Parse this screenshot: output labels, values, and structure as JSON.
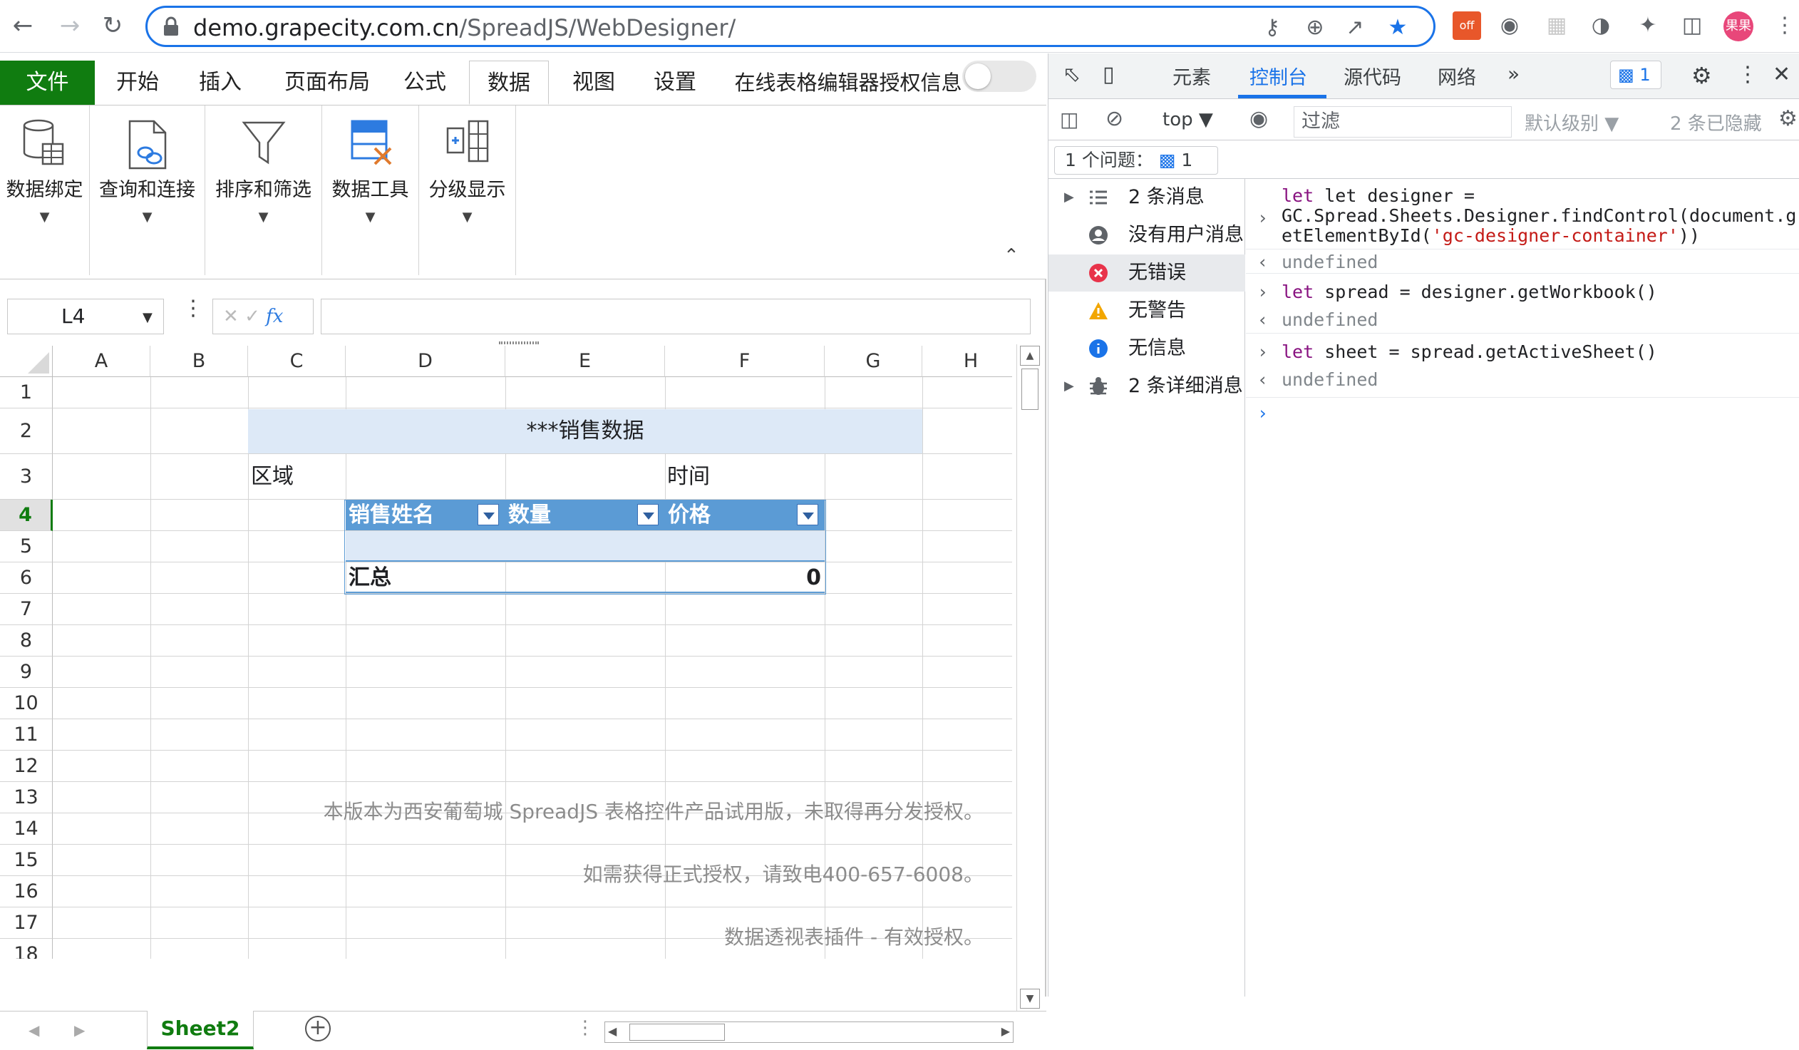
{
  "browser": {
    "url_host": "demo.grapecity.com.cn",
    "url_path": "/SpreadJS/WebDesigner/",
    "avatar_label": "果果",
    "ext_badge": "off"
  },
  "ribbon": {
    "tabs": [
      "文件",
      "开始",
      "插入",
      "页面布局",
      "公式",
      "数据",
      "视图",
      "设置",
      "在线表格编辑器授权信息"
    ],
    "active_tab": "数据",
    "groups": [
      "数据绑定",
      "查询和连接",
      "排序和筛选",
      "数据工具",
      "分级显示"
    ]
  },
  "formula_bar": {
    "name_box": "L4",
    "fx_label": "fx",
    "formula": ""
  },
  "grid": {
    "columns": [
      "A",
      "B",
      "C",
      "D",
      "E",
      "F",
      "G",
      "H"
    ],
    "rows": [
      "1",
      "2",
      "3",
      "4",
      "5",
      "6",
      "7",
      "8",
      "9",
      "10",
      "11",
      "12",
      "13",
      "14",
      "15",
      "16",
      "17",
      "18"
    ],
    "active_row": "4",
    "title": "***销售数据",
    "label_region": "区域",
    "label_time": "时间",
    "table_headers": [
      "销售姓名",
      "数量",
      "价格"
    ],
    "total_label": "汇总",
    "total_value": "0",
    "watermark": [
      "本版本为西安葡萄城 SpreadJS 表格控件产品试用版，未取得再分发授权。",
      "如需获得正式授权，请致电400-657-6008。",
      "数据透视表插件 - 有效授权。"
    ]
  },
  "sheet_tabs": {
    "active": "Sheet2"
  },
  "devtools": {
    "tabs": [
      "元素",
      "控制台",
      "源代码",
      "网络"
    ],
    "active_tab": "控制台",
    "issue_count": "1",
    "context": "top",
    "filter_placeholder": "过滤",
    "level": "默认级别",
    "hidden": "2 条已隐藏",
    "issues_label": "1 个问题：",
    "issues_count": "1",
    "sidebar": [
      {
        "label": "2 条消息",
        "icon": "list-icon"
      },
      {
        "label": "没有用户消息",
        "icon": "user-icon"
      },
      {
        "label": "无错误",
        "icon": "error-icon"
      },
      {
        "label": "无警告",
        "icon": "warning-icon"
      },
      {
        "label": "无信息",
        "icon": "info-icon"
      },
      {
        "label": "2 条详细消息",
        "icon": "bug-icon"
      }
    ],
    "console": {
      "cmd1_a": "let designer =",
      "cmd1_b": "GC.Spread.Sheets.Designer.findControl(document.g",
      "cmd1_c1": "etElementById(",
      "cmd1_c2": "'gc-designer-container'",
      "cmd1_c3": "))",
      "res1": "undefined",
      "cmd2": "spread = designer.getWorkbook()",
      "res2": "undefined",
      "cmd3": "sheet = spread.getActiveSheet()",
      "res3": "undefined",
      "kw": "let"
    }
  },
  "colors": {
    "excel_green": "#107c10",
    "accent_blue": "#1a73e8",
    "title_fill": "#dde9f7",
    "table_header_fill": "#5b9bd5",
    "table_row_fill": "#dde9f7"
  }
}
